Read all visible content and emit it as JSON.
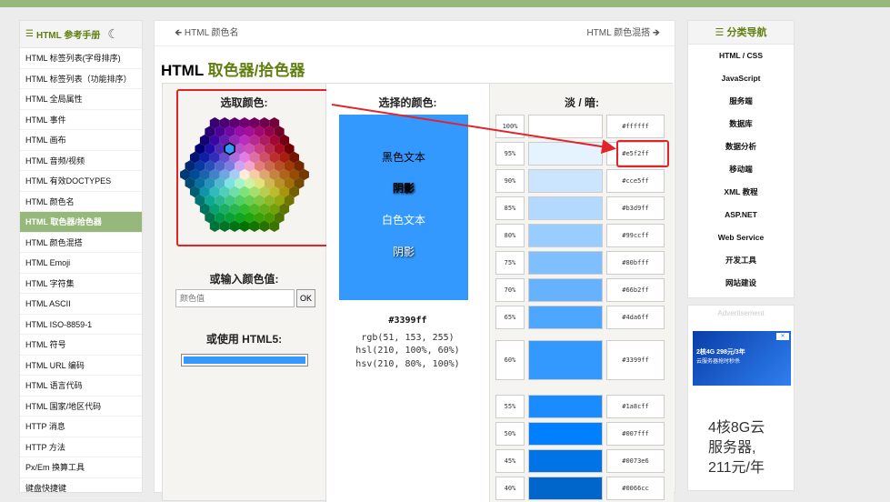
{
  "left_nav": {
    "title": "HTML 参考手册",
    "items": [
      "HTML 标签列表(字母排序)",
      "HTML 标签列表（功能排序）",
      "HTML 全局属性",
      "HTML 事件",
      "HTML 画布",
      "HTML 音频/视频",
      "HTML 有效DOCTYPES",
      "HTML 颜色名",
      "HTML 取色器/拾色器",
      "HTML 颜色混搭",
      "HTML Emoji",
      "HTML 字符集",
      "HTML ASCII",
      "HTML ISO-8859-1",
      "HTML 符号",
      "HTML URL 编码",
      "HTML 语言代码",
      "HTML 国家/地区代码",
      "HTTP 消息",
      "HTTP 方法",
      "Px/Em 换算工具",
      "键盘快捷键"
    ],
    "active_index": 8
  },
  "breadcrumb": {
    "prev": "HTML 颜色名",
    "next": "HTML 颜色混搭"
  },
  "page_title": {
    "prefix": "HTML ",
    "highlight": "取色器/拾色器"
  },
  "picker": {
    "pick_label": "选取颜色:",
    "input_label": "或输入颜色值:",
    "input_placeholder": "颜色值",
    "ok_label": "OK",
    "html5_label": "或使用 HTML5:"
  },
  "selected": {
    "label": "选择的颜色:",
    "black_text": "黑色文本",
    "shadow1": "阴影",
    "white_text": "白色文本",
    "shadow2": "阴影",
    "hex": "#3399ff",
    "rgb": "rgb(51, 153, 255)",
    "hsl": "hsl(210, 100%, 60%)",
    "hsv": "hsv(210, 80%, 100%)",
    "color": "#3399ff"
  },
  "shades": {
    "label": "淡 / 暗:",
    "rows": [
      {
        "pct": "100%",
        "hex": "#ffffff"
      },
      {
        "pct": "95%",
        "hex": "#e5f2ff"
      },
      {
        "pct": "90%",
        "hex": "#cce5ff"
      },
      {
        "pct": "85%",
        "hex": "#b3d9ff"
      },
      {
        "pct": "80%",
        "hex": "#99ccff"
      },
      {
        "pct": "75%",
        "hex": "#80bfff"
      },
      {
        "pct": "70%",
        "hex": "#66b2ff"
      },
      {
        "pct": "65%",
        "hex": "#4da6ff"
      },
      {
        "pct": "60%",
        "hex": "#3399ff"
      },
      {
        "pct": "55%",
        "hex": "#1a8cff"
      },
      {
        "pct": "50%",
        "hex": "#007fff"
      },
      {
        "pct": "45%",
        "hex": "#0073e6"
      },
      {
        "pct": "40%",
        "hex": "#0066cc"
      }
    ]
  },
  "right_nav": {
    "title": "分类导航",
    "items": [
      "HTML / CSS",
      "JavaScript",
      "服务端",
      "数据库",
      "数据分析",
      "移动端",
      "XML 教程",
      "ASP.NET",
      "Web Service",
      "开发工具",
      "网站建设"
    ]
  },
  "ad": {
    "label": "Advertisement",
    "banner_line1": "2核4G 298元/3年",
    "banner_line2": "云服务器抢时秒杀",
    "text_line1": "4核8G云",
    "text_line2": "服务器,",
    "text_line3": "211元/年"
  },
  "colors": {
    "accent": "#617f10",
    "nav_active": "#96b97b",
    "annotation": "#e2242a"
  }
}
